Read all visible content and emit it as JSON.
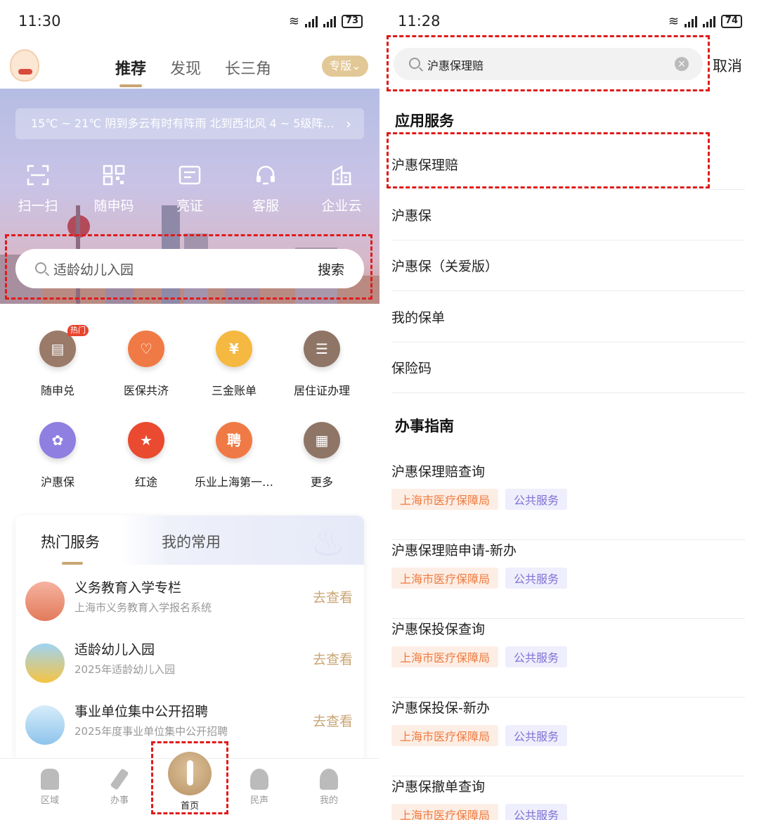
{
  "left": {
    "status": {
      "time": "11:30",
      "battery": "73"
    },
    "nav": {
      "tabs": [
        "推荐",
        "发现",
        "长三角"
      ],
      "edition": "专版"
    },
    "weather": "15℃ ~ 21℃  阴到多云有时有阵雨  北到西北风  4 ~ 5级阵…",
    "quick": [
      {
        "label": "扫一扫",
        "icon": "scan-icon"
      },
      {
        "label": "随申码",
        "icon": "qrcode-icon"
      },
      {
        "label": "亮证",
        "icon": "id-card-icon"
      },
      {
        "label": "客服",
        "icon": "headset-icon"
      },
      {
        "label": "企业云",
        "icon": "building-icon"
      }
    ],
    "search": {
      "placeholder": "适龄幼儿入园",
      "button": "搜索"
    },
    "grid": [
      {
        "label": "随申兑",
        "badge": "热门",
        "color": "#9a7a68"
      },
      {
        "label": "医保共济",
        "color": "#f07a45"
      },
      {
        "label": "三金账单",
        "color": "#f5b840"
      },
      {
        "label": "居住证办理",
        "color": "#8f7566"
      },
      {
        "label": "沪惠保",
        "color": "#8e7fe0"
      },
      {
        "label": "红途",
        "color": "#ea4a2f"
      },
      {
        "label": "乐业上海第一…",
        "glyph": "聘",
        "color": "#f07a45"
      },
      {
        "label": "更多",
        "color": "#8f7566"
      }
    ],
    "services": {
      "tabs": [
        "热门服务",
        "我的常用"
      ],
      "items": [
        {
          "title": "义务教育入学专栏",
          "sub": "上海市义务教育入学报名系统",
          "action": "去查看"
        },
        {
          "title": "适龄幼儿入园",
          "sub": "2025年适龄幼儿入园",
          "action": "去查看"
        },
        {
          "title": "事业单位集中公开招聘",
          "sub": "2025年度事业单位集中公开招聘",
          "action": "去查看"
        }
      ]
    },
    "bottom": [
      "区域",
      "办事",
      "首页",
      "民声",
      "我的"
    ]
  },
  "right": {
    "status": {
      "time": "11:28",
      "battery": "74"
    },
    "search": {
      "value": "沪惠保理赔",
      "cancel": "取消"
    },
    "app_section": "应用服务",
    "apps": [
      "沪惠保理赔",
      "沪惠保",
      "沪惠保（关爱版）",
      "我的保单",
      "保险码"
    ],
    "guide_section": "办事指南",
    "guides": [
      {
        "title": "沪惠保理赔查询",
        "tags": [
          "上海市医疗保障局",
          "公共服务"
        ]
      },
      {
        "title": "沪惠保理赔申请-新办",
        "tags": [
          "上海市医疗保障局",
          "公共服务"
        ]
      },
      {
        "title": "沪惠保投保查询",
        "tags": [
          "上海市医疗保障局",
          "公共服务"
        ]
      },
      {
        "title": "沪惠保投保-新办",
        "tags": [
          "上海市医疗保障局",
          "公共服务"
        ]
      },
      {
        "title": "沪惠保撤单查询",
        "tags": [
          "上海市医疗保障局",
          "公共服务"
        ]
      }
    ]
  }
}
